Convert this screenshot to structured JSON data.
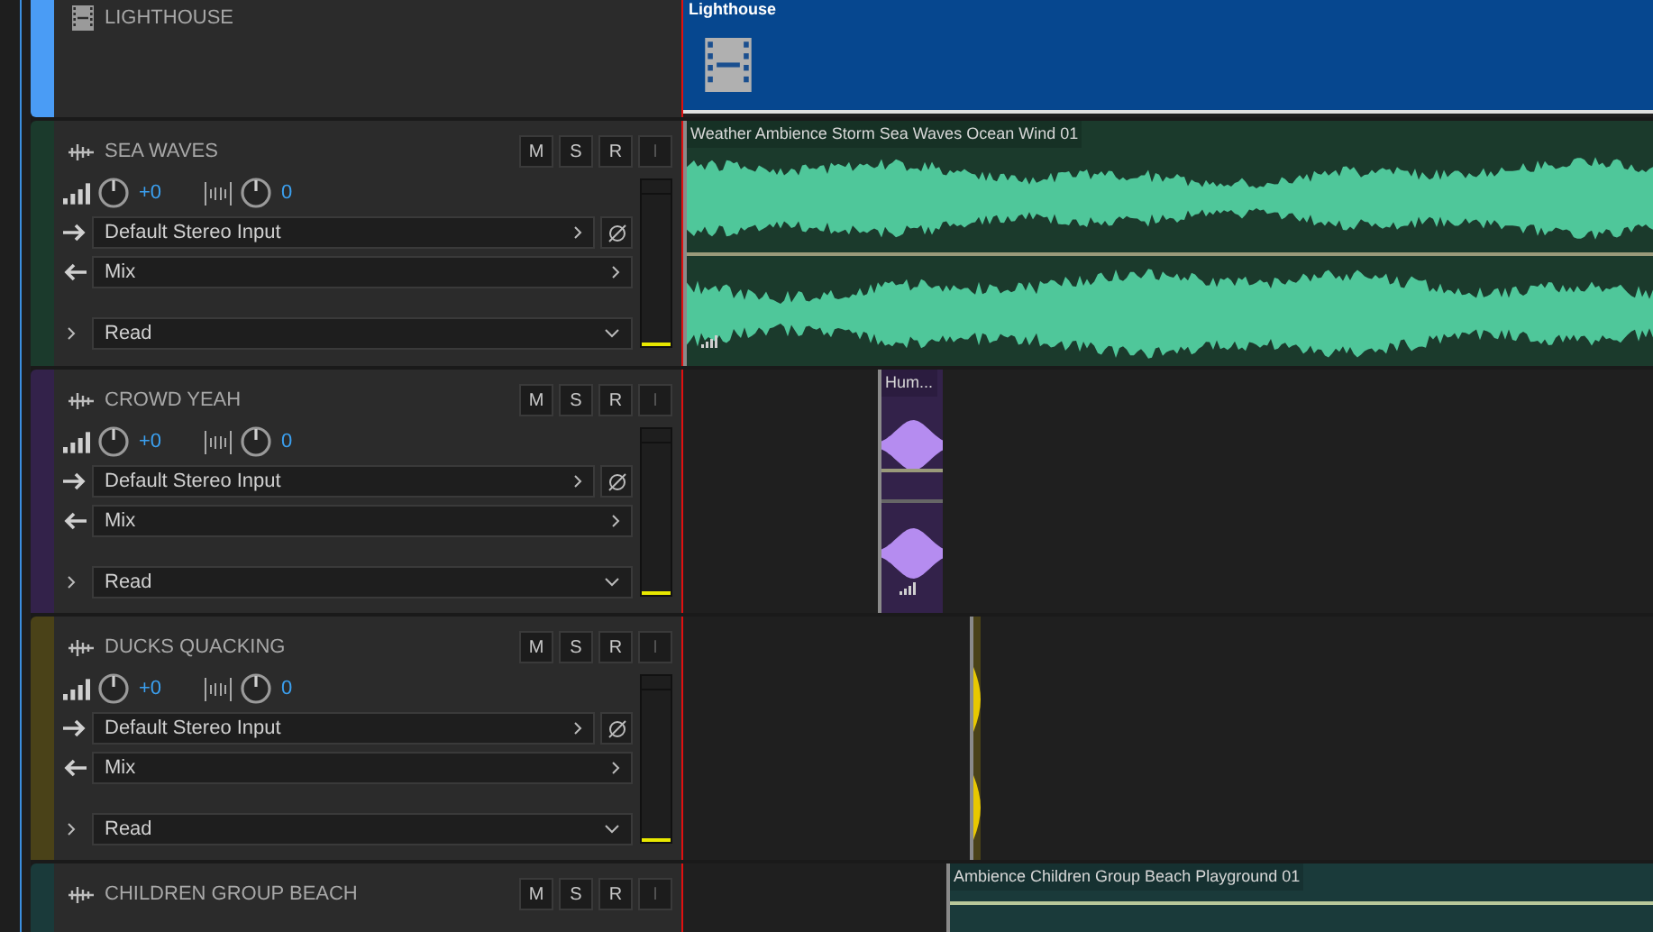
{
  "tracks": [
    {
      "kind": "video",
      "name": "LIGHTHOUSE",
      "color": "#4a9cf5",
      "clip": {
        "name": "Lighthouse"
      }
    },
    {
      "kind": "audio",
      "name": "SEA WAVES",
      "color": "#1b3a2c",
      "volume": "+0",
      "pan": "0",
      "input": "Default Stereo Input",
      "output": "Mix",
      "automation": "Read",
      "buttons": [
        {
          "label": "M",
          "disabled": false
        },
        {
          "label": "S",
          "disabled": false
        },
        {
          "label": "R",
          "disabled": false
        },
        {
          "label": "I",
          "disabled": true
        }
      ],
      "meter": {
        "level": 0.02
      },
      "clip": {
        "name": "Weather Ambience Storm Sea Waves Ocean Wind 01"
      }
    },
    {
      "kind": "audio",
      "name": "CROWD YEAH",
      "color": "#33224a",
      "volume": "+0",
      "pan": "0",
      "input": "Default Stereo Input",
      "output": "Mix",
      "automation": "Read",
      "buttons": [
        {
          "label": "M",
          "disabled": false
        },
        {
          "label": "S",
          "disabled": false
        },
        {
          "label": "R",
          "disabled": false
        },
        {
          "label": "I",
          "disabled": true
        }
      ],
      "meter": {
        "level": 0.02
      },
      "clip": {
        "name": "Hum..."
      }
    },
    {
      "kind": "audio",
      "name": "DUCKS QUACKING",
      "color": "#4a4218",
      "volume": "+0",
      "pan": "0",
      "input": "Default Stereo Input",
      "output": "Mix",
      "automation": "Read",
      "buttons": [
        {
          "label": "M",
          "disabled": false
        },
        {
          "label": "S",
          "disabled": false
        },
        {
          "label": "R",
          "disabled": false
        },
        {
          "label": "I",
          "disabled": true
        }
      ],
      "meter": {
        "level": 0.02
      },
      "clip": {
        "kind": "blip"
      }
    },
    {
      "kind": "collapsed",
      "name": "CHILDREN GROUP BEACH",
      "color": "#1a3a3a",
      "buttons": [
        {
          "label": "M",
          "disabled": false
        },
        {
          "label": "S",
          "disabled": false
        },
        {
          "label": "R",
          "disabled": false
        },
        {
          "label": "I",
          "disabled": true
        }
      ],
      "clip": {
        "name": "Ambience Children Group Beach Playground 01"
      }
    }
  ]
}
